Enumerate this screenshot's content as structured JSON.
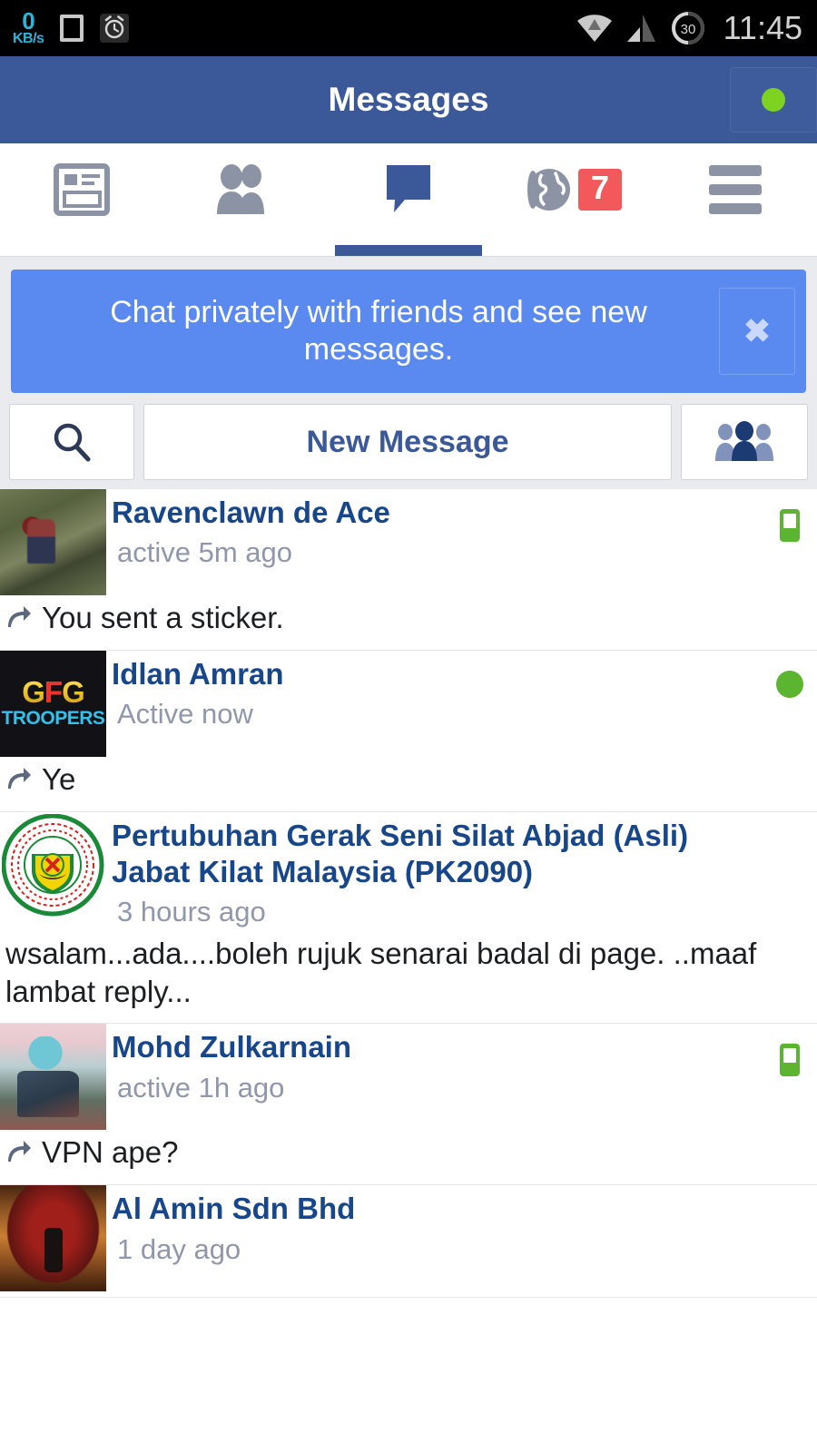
{
  "status_bar": {
    "net_speed_value": "0",
    "net_speed_unit": "KB/s",
    "sd_icon": "sd-card-icon",
    "alarm_icon": "alarm-clock-icon",
    "wifi_icon": "wifi-icon",
    "signal_icon": "cellular-signal-icon",
    "battery_level": "30",
    "clock": "11:45",
    "accent_color": "#29b6d8"
  },
  "header": {
    "title": "Messages",
    "brand_color": "#3b5998",
    "status_toggle": {
      "icon": "online-status-dot-icon",
      "color": "#7ed321"
    }
  },
  "tabs": [
    {
      "name": "news-feed",
      "icon": "news-feed-icon",
      "active": false,
      "badge": ""
    },
    {
      "name": "friends",
      "icon": "friends-icon",
      "active": false,
      "badge": ""
    },
    {
      "name": "messages",
      "icon": "messages-icon",
      "active": true,
      "badge": ""
    },
    {
      "name": "notifications",
      "icon": "globe-icon",
      "active": false,
      "badge": "7"
    },
    {
      "name": "more",
      "icon": "hamburger-menu-icon",
      "active": false,
      "badge": ""
    }
  ],
  "badge_color": "#f3595b",
  "promo": {
    "text": "Chat privately with friends and see new messages.",
    "close_label": "✖",
    "background": "#5a8af0"
  },
  "actions": {
    "search_icon": "search-icon",
    "new_message_label": "New Message",
    "group_icon": "group-people-icon"
  },
  "conversations": [
    {
      "name": "Ravenclawn de Ace",
      "time": "active 5m ago",
      "snippet": "You sent a sticker.",
      "has_reply_arrow": true,
      "indicator": "mobile",
      "avatar": "photo-rock-person"
    },
    {
      "name": "Idlan Amran",
      "time": "Active now",
      "snippet": "Ye",
      "has_reply_arrow": true,
      "indicator": "dot",
      "avatar": "gfg-troopers-logo",
      "avatar_text_top": "GFG",
      "avatar_text_bottom": "TROOPERS"
    },
    {
      "name": "Pertubuhan Gerak Seni Silat Abjad (Asli) Jabat Kilat Malaysia (PK2090)",
      "time": "3 hours ago",
      "snippet": "wsalam...ada....boleh rujuk senarai badal di page. ..maaf lambat reply...",
      "has_reply_arrow": false,
      "indicator": "none",
      "avatar": "silat-association-seal"
    },
    {
      "name": "Mohd Zulkarnain",
      "time": "active 1h ago",
      "snippet": "VPN ape?",
      "has_reply_arrow": true,
      "indicator": "mobile",
      "avatar": "photo-person"
    },
    {
      "name": "Al Amin Sdn Bhd",
      "time": "1 day ago",
      "snippet": "",
      "has_reply_arrow": false,
      "indicator": "none",
      "avatar": "photo-red-object"
    }
  ],
  "colors": {
    "link": "#17478a",
    "muted": "#9197ab",
    "online": "#5cb531",
    "page_bg": "#e9ebee"
  }
}
